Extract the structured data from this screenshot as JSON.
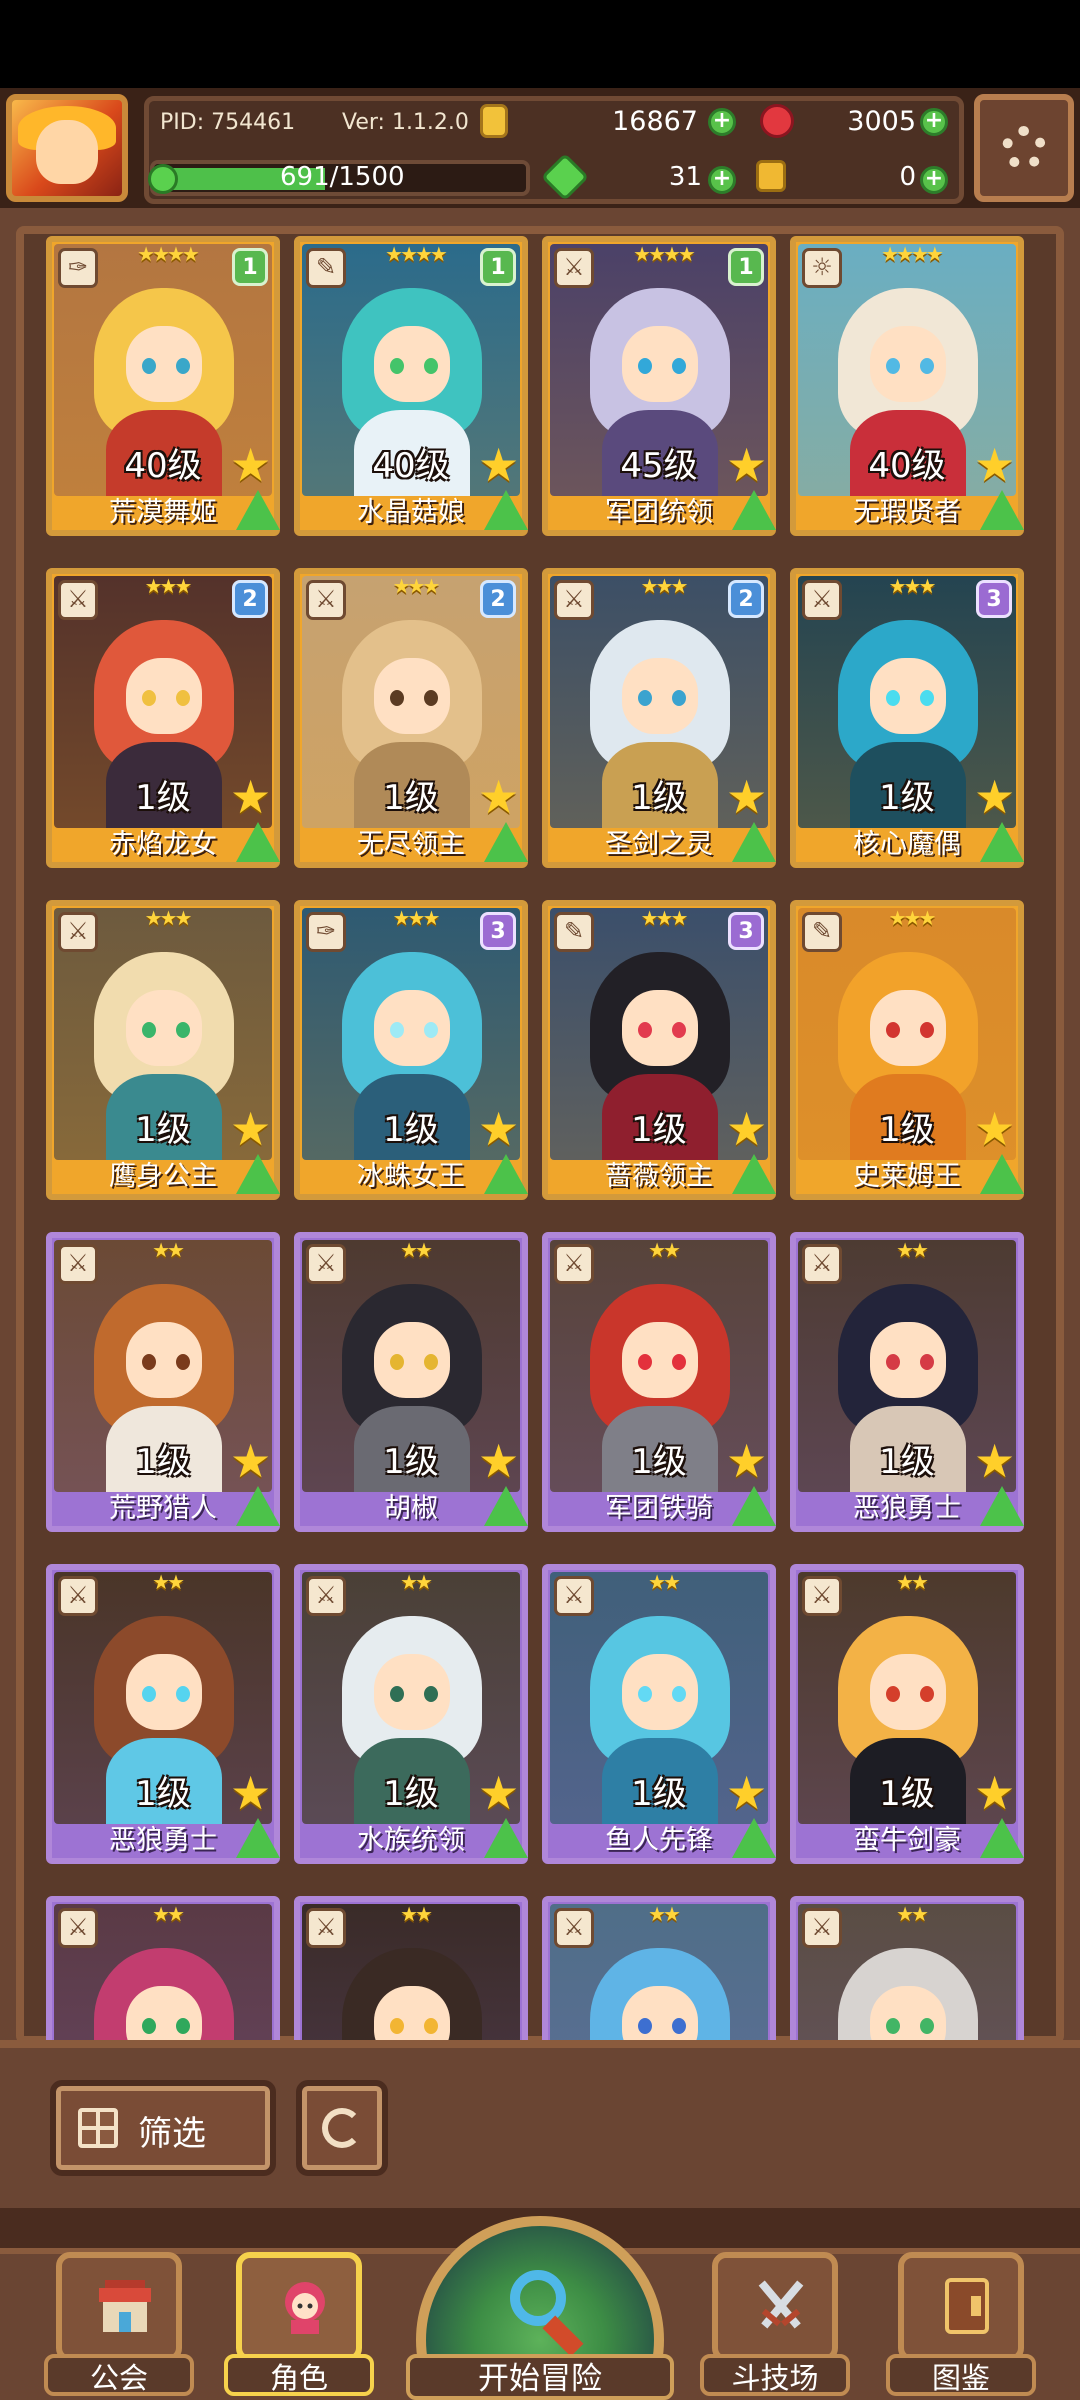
{
  "hud": {
    "pid": "PID: 754461",
    "version": "Ver: 1.1.2.0",
    "gold": "16867",
    "gems": "3005",
    "xp": "691/1500",
    "xp_fraction": 0.46,
    "shards": "31",
    "keys": "0",
    "icons": {
      "settings": "gear-icon",
      "gold": "coin-icon",
      "gems": "gem-icon",
      "shards": "clover-shard-icon",
      "keys": "key-icon",
      "xp": "xp-icon",
      "plus": "plus-icon"
    }
  },
  "cards": [
    {
      "name": "荒漠舞姬",
      "level": "40级",
      "rarity": "gold",
      "stars": "★★★★",
      "rank": "1",
      "type": "feather-icon",
      "hair": "#f5c64a",
      "outfit": "#c53b2b",
      "eyes": "#3aa7c9",
      "bg": "#b37641"
    },
    {
      "name": "水晶菇娘",
      "level": "40级",
      "rarity": "gold",
      "stars": "★★★★",
      "rank": "1",
      "type": "wand-icon",
      "hair": "#3fc3c0",
      "outfit": "#e8f2f7",
      "eyes": "#44c46a",
      "bg": "#2b6b8b"
    },
    {
      "name": "军团统领",
      "level": "45级",
      "rarity": "gold",
      "stars": "★★★★",
      "rank": "1",
      "type": "sword-icon",
      "hair": "#c8c2e3",
      "outfit": "#5a4a7d",
      "eyes": "#32a8d9",
      "bg": "#4b4168"
    },
    {
      "name": "无瑕贤者",
      "level": "40级",
      "rarity": "gold",
      "stars": "★★★★",
      "rank": "",
      "type": "sun-icon",
      "hair": "#f1e7d6",
      "outfit": "#c92f3a",
      "eyes": "#52b9e4",
      "bg": "#6aaec2"
    },
    {
      "name": "赤焰龙女",
      "level": "1级",
      "rarity": "gold",
      "stars": "★★★",
      "rank": "2",
      "type": "sword-icon",
      "hair": "#e0583b",
      "outfit": "#3b2b3b",
      "eyes": "#f0c040",
      "bg": "#54322b"
    },
    {
      "name": "无尽领主",
      "level": "1级",
      "rarity": "gold",
      "stars": "★★★",
      "rank": "2",
      "type": "sword-icon",
      "hair": "#e3c08b",
      "outfit": "#b08a58",
      "eyes": "#5b3b22",
      "bg": "#c6a271"
    },
    {
      "name": "圣剑之灵",
      "level": "1级",
      "rarity": "gold",
      "stars": "★★★",
      "rank": "2",
      "type": "sword-icon",
      "hair": "#dfe8ef",
      "outfit": "#c9a052",
      "eyes": "#3ba3cf",
      "bg": "#3c4f66"
    },
    {
      "name": "核心魔偶",
      "level": "1级",
      "rarity": "gold",
      "stars": "★★★",
      "rank": "3",
      "type": "sword-icon",
      "hair": "#2ca8c9",
      "outfit": "#1e4f5e",
      "eyes": "#4bdcef",
      "bg": "#244451"
    },
    {
      "name": "鹰身公主",
      "level": "1级",
      "rarity": "gold",
      "stars": "★★★",
      "rank": "",
      "type": "sword-icon",
      "hair": "#f1dcae",
      "outfit": "#3a8a8f",
      "eyes": "#3ab56a",
      "bg": "#6d5a3e"
    },
    {
      "name": "冰蛛女王",
      "level": "1级",
      "rarity": "gold",
      "stars": "★★★",
      "rank": "3",
      "type": "feather-icon",
      "hair": "#4cc0d8",
      "outfit": "#2b5f7a",
      "eyes": "#9eeaf5",
      "bg": "#2e5a72"
    },
    {
      "name": "蔷薇领主",
      "level": "1级",
      "rarity": "gold",
      "stars": "★★★",
      "rank": "3",
      "type": "wand-icon",
      "hair": "#222026",
      "outfit": "#8f1f2e",
      "eyes": "#e23b4e",
      "bg": "#3b4f6b"
    },
    {
      "name": "史莱姆王",
      "level": "1级",
      "rarity": "gold",
      "stars": "★★★",
      "rank": "",
      "type": "wand-icon",
      "hair": "#f2a22a",
      "outfit": "#e07b1f",
      "eyes": "#d2352f",
      "bg": "#d98a2a"
    },
    {
      "name": "荒野猎人",
      "level": "1级",
      "rarity": "purple",
      "stars": "★★",
      "rank": "",
      "type": "sword-icon",
      "hair": "#c06a2d",
      "outfit": "#efe7dc",
      "eyes": "#7a3b1c",
      "bg": "#6b4a35"
    },
    {
      "name": "胡椒",
      "level": "1级",
      "rarity": "purple",
      "stars": "★★",
      "rank": "",
      "type": "sword-icon",
      "hair": "#2a2830",
      "outfit": "#6a6a72",
      "eyes": "#e5b531",
      "bg": "#4e3a30"
    },
    {
      "name": "军团铁骑",
      "level": "1级",
      "rarity": "purple",
      "stars": "★★",
      "rank": "",
      "type": "sword-icon",
      "hair": "#c9362b",
      "outfit": "#7f7f88",
      "eyes": "#e3313c",
      "bg": "#57433a"
    },
    {
      "name": "恶狼勇士",
      "level": "1级",
      "rarity": "purple",
      "stars": "★★",
      "rank": "",
      "type": "sword-icon",
      "hair": "#23243a",
      "outfit": "#d8c7b6",
      "eyes": "#d53b45",
      "bg": "#4d3b32"
    },
    {
      "name": "恶狼勇士",
      "level": "1级",
      "rarity": "purple",
      "stars": "★★",
      "rank": "",
      "type": "sword-icon",
      "hair": "#8c4a2b",
      "outfit": "#5fc8e6",
      "eyes": "#55d4ef",
      "bg": "#4a3528"
    },
    {
      "name": "水族统领",
      "level": "1级",
      "rarity": "purple",
      "stars": "★★",
      "rank": "",
      "type": "sword-icon",
      "hair": "#e6ecef",
      "outfit": "#3c6a5c",
      "eyes": "#2f6f55",
      "bg": "#4a4036"
    },
    {
      "name": "鱼人先锋",
      "level": "1级",
      "rarity": "purple",
      "stars": "★★",
      "rank": "",
      "type": "sword-icon",
      "hair": "#57c6e2",
      "outfit": "#2e7fa5",
      "eyes": "#63d9f4",
      "bg": "#40607a"
    },
    {
      "name": "蛮牛剑豪",
      "level": "1级",
      "rarity": "purple",
      "stars": "★★",
      "rank": "",
      "type": "sword-icon",
      "hair": "#f3b246",
      "outfit": "#1d1d24",
      "eyes": "#d43f2b",
      "bg": "#4d3a2c"
    },
    {
      "name": "",
      "level": "",
      "rarity": "purple",
      "stars": "★★",
      "rank": "",
      "type": "sword-icon",
      "hair": "#c23d6f",
      "outfit": "#6b2a46",
      "eyes": "#2fa85c",
      "bg": "#5a3a45"
    },
    {
      "name": "",
      "level": "",
      "rarity": "purple",
      "stars": "★★",
      "rank": "",
      "type": "sword-icon",
      "hair": "#3a2a24",
      "outfit": "#d2571f",
      "eyes": "#f2b533",
      "bg": "#3a2b28"
    },
    {
      "name": "",
      "level": "",
      "rarity": "purple",
      "stars": "★★",
      "rank": "",
      "type": "sword-icon",
      "hair": "#5fb4e6",
      "outfit": "#2f8ed0",
      "eyes": "#3d6fd0",
      "bg": "#4f6e88"
    },
    {
      "name": "",
      "level": "",
      "rarity": "purple",
      "stars": "★★",
      "rank": "",
      "type": "sword-icon",
      "hair": "#d7d3d0",
      "outfit": "#6e655e",
      "eyes": "#42b565",
      "bg": "#5a4d44"
    }
  ],
  "filter": {
    "label": "筛选",
    "icon": "grid-icon"
  },
  "refresh": {
    "icon": "refresh-icon"
  },
  "nav": {
    "guild": {
      "label": "公会",
      "icon": "guild-building-icon"
    },
    "roles": {
      "label": "角色",
      "icon": "character-icon"
    },
    "adventure": {
      "label": "开始冒险",
      "icon": "magnifier-map-icon"
    },
    "arena": {
      "label": "斗技场",
      "icon": "crossed-swords-icon"
    },
    "codex": {
      "label": "图鉴",
      "icon": "book-icon"
    }
  },
  "colors": {
    "gold_frame": "#f0a62b",
    "purple_frame": "#9d73d3",
    "panel": "#6a4533",
    "accent_green": "#4cc24a"
  }
}
